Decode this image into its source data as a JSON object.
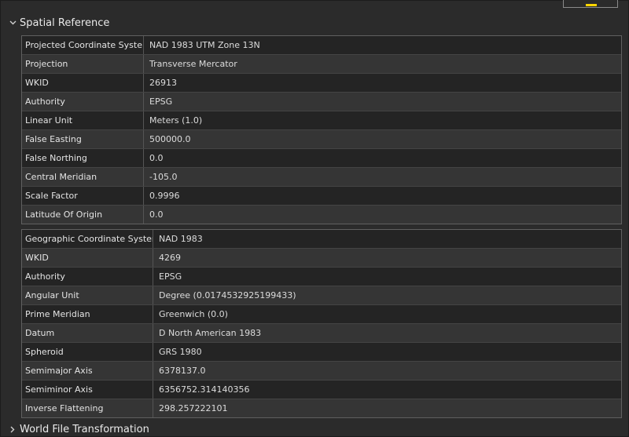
{
  "sections": {
    "spatial_reference": {
      "title": "Spatial Reference",
      "expanded": true
    },
    "world_file": {
      "title": "World File Transformation",
      "expanded": false
    }
  },
  "projected": {
    "rows": [
      {
        "label": "Projected Coordinate System",
        "value": "NAD 1983 UTM Zone 13N"
      },
      {
        "label": "Projection",
        "value": "Transverse Mercator"
      },
      {
        "label": "WKID",
        "value": "26913"
      },
      {
        "label": "Authority",
        "value": "EPSG"
      },
      {
        "label": "Linear Unit",
        "value": "Meters (1.0)"
      },
      {
        "label": "False Easting",
        "value": "500000.0"
      },
      {
        "label": "False Northing",
        "value": "0.0"
      },
      {
        "label": "Central Meridian",
        "value": "-105.0"
      },
      {
        "label": "Scale Factor",
        "value": "0.9996"
      },
      {
        "label": "Latitude Of Origin",
        "value": "0.0"
      }
    ]
  },
  "geographic": {
    "rows": [
      {
        "label": "Geographic Coordinate System",
        "value": "NAD 1983"
      },
      {
        "label": "WKID",
        "value": "4269"
      },
      {
        "label": "Authority",
        "value": "EPSG"
      },
      {
        "label": "Angular Unit",
        "value": "Degree (0.0174532925199433)"
      },
      {
        "label": "Prime Meridian",
        "value": "Greenwich (0.0)"
      },
      {
        "label": "Datum",
        "value": "D North American 1983"
      },
      {
        "label": "Spheroid",
        "value": "GRS 1980"
      },
      {
        "label": "Semimajor Axis",
        "value": "6378137.0"
      },
      {
        "label": "Semiminor Axis",
        "value": "6356752.314140356"
      },
      {
        "label": "Inverse Flattening",
        "value": "298.257222101"
      }
    ]
  },
  "colors": {
    "background": "#2b2b2b",
    "row_dark": "#242424",
    "row_light": "#353535",
    "accent": "#ffd400"
  }
}
